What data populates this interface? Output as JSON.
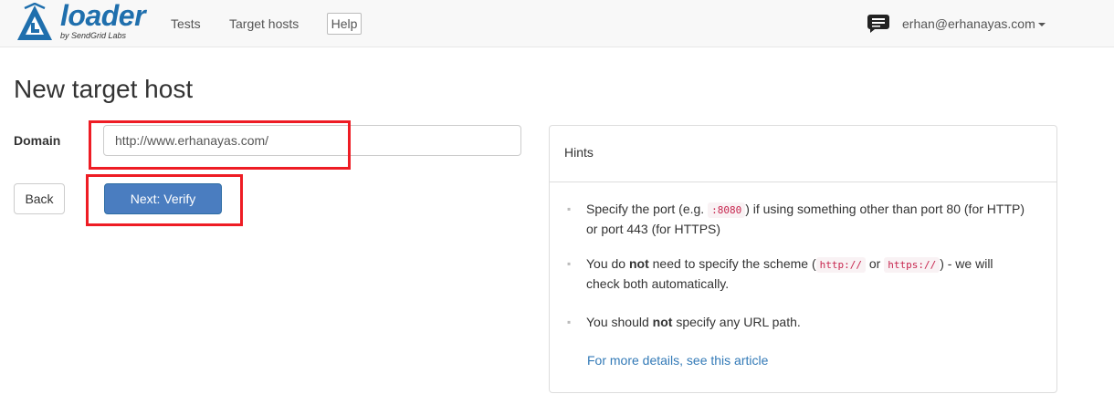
{
  "nav": {
    "brand": "loader",
    "brand_sub": "by SendGrid Labs",
    "links": [
      "Tests",
      "Target hosts"
    ],
    "help": "Help",
    "user": "erhan@erhanayas.com"
  },
  "page": {
    "title": "New target host",
    "domain_label": "Domain",
    "domain_value": "http://www.erhanayas.com/",
    "back_label": "Back",
    "next_label": "Next: Verify"
  },
  "hints": {
    "heading": "Hints",
    "h1_a": "Specify the port (e.g. ",
    "h1_code": ":8080",
    "h1_b": ") if using something other than port 80 (for HTTP) or port 443 (for HTTPS)",
    "h2_a": "You do ",
    "h2_bold": "not",
    "h2_b": " need to specify the scheme (",
    "h2_code1": "http://",
    "h2_or": " or ",
    "h2_code2": "https://",
    "h2_c": ") - we will check both automatically.",
    "h3_a": "You should ",
    "h3_bold": "not",
    "h3_b": " specify any URL path.",
    "link": "For more details, see this article"
  },
  "colors": {
    "brand": "#1f6fad",
    "primary_button": "#4a7dc0",
    "highlight_box": "#ee1c24",
    "link": "#337ab7",
    "code_text": "#c7254e"
  },
  "icons": [
    "loader-logo-icon",
    "chat-icon",
    "caret-down-icon"
  ]
}
